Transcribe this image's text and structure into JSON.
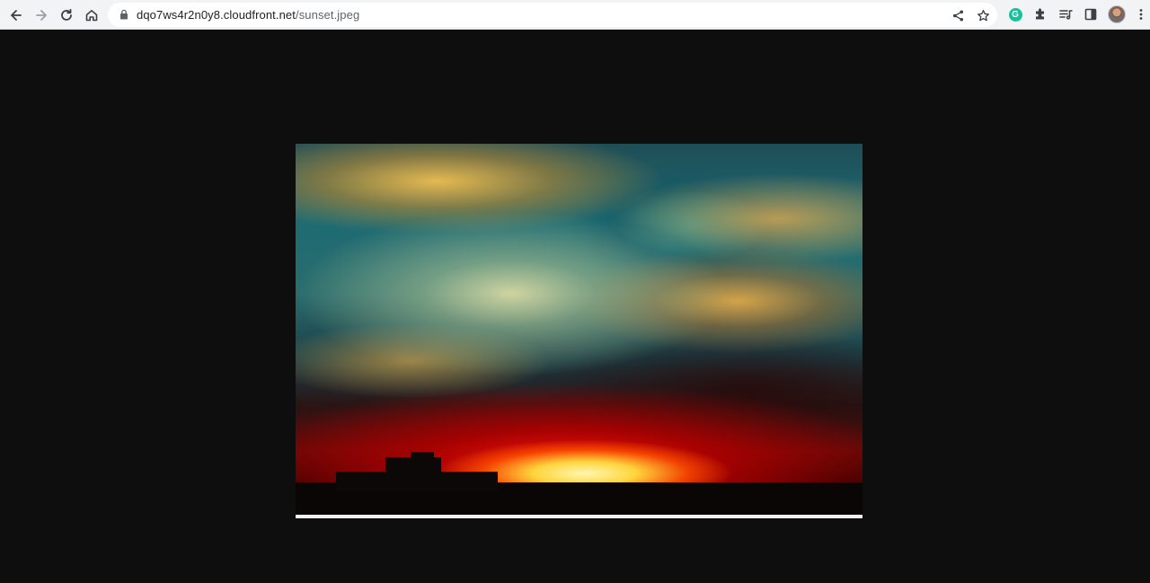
{
  "browser": {
    "url_host": "dqo7ws4r2n0y8.cloudfront.net",
    "url_path": "/sunset.jpeg",
    "extension_badge": "G"
  },
  "icons": {
    "back": "arrow-left-icon",
    "forward": "arrow-right-icon",
    "reload": "reload-icon",
    "home": "home-icon",
    "lock": "lock-icon",
    "share": "share-icon",
    "bookmark": "star-icon",
    "grammarly": "grammarly-icon",
    "extensions": "puzzle-icon",
    "reading_list": "reading-list-icon",
    "side_panel": "side-panel-icon",
    "profile": "avatar",
    "menu": "more-vert-icon"
  },
  "colors": {
    "toolbar_bg": "#f1f3f4",
    "page_bg": "#0e0e0e",
    "grammarly_green": "#15c39a"
  },
  "image": {
    "description_role": "displayed image",
    "filename": "sunset.jpeg"
  }
}
